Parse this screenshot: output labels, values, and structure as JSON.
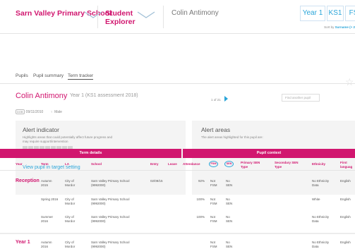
{
  "topbar": {
    "school_name": "Sarn Valley Primary School",
    "product_name": "Student Explorer",
    "pupil_name": "Colin Antimony",
    "year_button": "Year 1",
    "ks_button": "KS1",
    "fourth_button": "FS",
    "sort_prefix": "Sort by",
    "sort_value": "Surname (+ 2"
  },
  "tabs": [
    {
      "label": "Pupils"
    },
    {
      "label": "Pupil summary"
    },
    {
      "label": "Term tracker",
      "active": true
    }
  ],
  "pupil": {
    "name": "Colin Antimony",
    "year_label": "Year 1 (KS1 assessment 2018)",
    "dob_tag": "DOB",
    "dob": "09/11/2010",
    "gender": "Male",
    "pager": "1 of 21",
    "find_placeholder": "Find another pupil"
  },
  "alert_indicator": {
    "title": "Alert indicator",
    "desc_line1": "Highlights areas that could potentially affect future progress and",
    "desc_line2": "may require support/intervention",
    "block_count": 9,
    "link": "View pupil in target setting"
  },
  "alert_areas": {
    "title": "Alert areas",
    "desc": "The alert areas highlighted for this pupil are:"
  },
  "table": {
    "group_headers": {
      "term_details": "Term details",
      "pupil_context": "Pupil context"
    },
    "columns": {
      "year": "Year",
      "term": "Term",
      "la": "LA",
      "school": "School",
      "entry": "Entry",
      "leave": "Leave",
      "attendance": "Attendance",
      "fsm": "FSM",
      "sen": "SEN",
      "primary_sen_1": "Primary SEN",
      "primary_sen_2": "Type",
      "secondary_sen_1": "Secondary SEN",
      "secondary_sen_2": "Type",
      "ethnicity": "Ethnicity",
      "first_lang_1": "First",
      "first_lang_2": "languag"
    },
    "rows": [
      {
        "year": "Reception",
        "term1": "Autumn",
        "term2": "2015",
        "la1": "City of",
        "la2": "Mordor",
        "school1": "Sarn Valley Primary School",
        "school2": "(9992000)",
        "entry": "02/09/15",
        "attendance": "92%",
        "fsm1": "Not",
        "fsm2": "FSM",
        "sen1": "No",
        "sen2": "SEN",
        "eth1": "No Ethnicity",
        "eth2": "Data",
        "lang": "English"
      },
      {
        "year": "",
        "term1": "Spring 2016",
        "term2": "",
        "la1": "City of",
        "la2": "Mordor",
        "school1": "Sarn Valley Primary School",
        "school2": "(9992000)",
        "entry": "",
        "attendance": "100%",
        "fsm1": "Not",
        "fsm2": "FSM",
        "sen1": "No",
        "sen2": "SEN",
        "eth1": "White",
        "eth2": "",
        "lang": "English"
      },
      {
        "year": "",
        "term1": "Summer",
        "term2": "2016",
        "la1": "City of",
        "la2": "Mordor",
        "school1": "Sarn Valley Primary School",
        "school2": "(9992000)",
        "entry": "",
        "attendance": "100%",
        "fsm1": "Not",
        "fsm2": "FSM",
        "sen1": "No",
        "sen2": "SEN",
        "eth1": "No Ethnicity",
        "eth2": "Data",
        "lang": "English"
      },
      {
        "year": "Year 1",
        "term1": "Autumn",
        "term2": "2016",
        "la1": "City of",
        "la2": "Mordor",
        "school1": "Sarn Valley Primary School",
        "school2": "(9992000)",
        "entry": "",
        "attendance": "",
        "fsm1": "Not",
        "fsm2": "FSM",
        "sen1": "No",
        "sen2": "SEN",
        "eth1": "No Ethnicity",
        "eth2": "Data",
        "lang": "English"
      }
    ]
  },
  "colors": {
    "brand": "#d1166f",
    "link": "#2aa5d9",
    "card": "#f4f4f4"
  }
}
